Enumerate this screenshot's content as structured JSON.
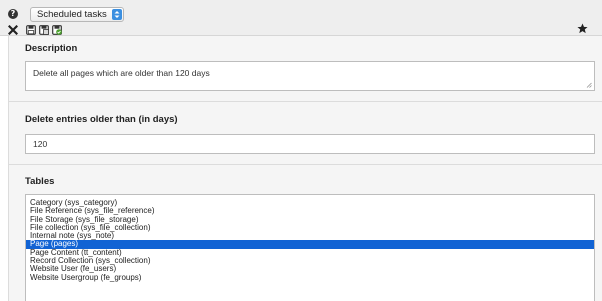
{
  "header": {
    "module_select": {
      "selected": "Scheduled tasks"
    },
    "toolbar": {
      "icons": [
        "close-icon",
        "save-icon",
        "save-and-view-icon",
        "save-and-close-icon"
      ]
    },
    "bookmark_icon": "star-icon"
  },
  "form": {
    "description": {
      "label": "Description",
      "value": "Delete all pages which are older than 120 days"
    },
    "days": {
      "label": "Delete entries older than (in days)",
      "value": "120"
    },
    "tables": {
      "label": "Tables",
      "options": [
        "Category (sys_category)",
        "File Reference (sys_file_reference)",
        "File Storage (sys_file_storage)",
        "File collection (sys_file_collection)",
        "Internal note (sys_note)",
        "Page (pages)",
        "Page Content (tt_content)",
        "Record Collection (sys_collection)",
        "Website User (fe_users)",
        "Website Usergroup (fe_groups)"
      ],
      "selected": "Page (pages)"
    }
  },
  "colors": {
    "selected_bg": "#1163d4",
    "select_arrow": "#3b8fe0"
  }
}
